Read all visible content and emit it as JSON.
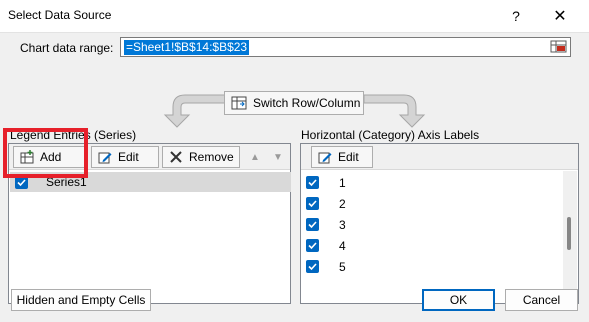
{
  "window": {
    "title": "Select Data Source",
    "help_glyph": "?",
    "close_glyph": "✕"
  },
  "range": {
    "label": "Chart data range:",
    "value": "=Sheet1!$B$14:$B$23"
  },
  "switch_button": {
    "label": "Switch Row/Column"
  },
  "legend": {
    "label": "Legend Entries (Series)",
    "add_label": "Add",
    "edit_label": "Edit",
    "remove_label": "Remove",
    "series": [
      {
        "name": "Series1",
        "checked": true
      }
    ]
  },
  "axis": {
    "label": "Horizontal (Category) Axis Labels",
    "edit_label": "Edit",
    "items": [
      {
        "label": "1",
        "checked": true
      },
      {
        "label": "2",
        "checked": true
      },
      {
        "label": "3",
        "checked": true
      },
      {
        "label": "4",
        "checked": true
      },
      {
        "label": "5",
        "checked": true
      }
    ]
  },
  "footer": {
    "hidden_label": "Hidden and Empty Cells",
    "ok_label": "OK",
    "cancel_label": "Cancel"
  },
  "colors": {
    "accent": "#0067c0",
    "highlight": "#e6202a",
    "selection": "#0078d7"
  }
}
